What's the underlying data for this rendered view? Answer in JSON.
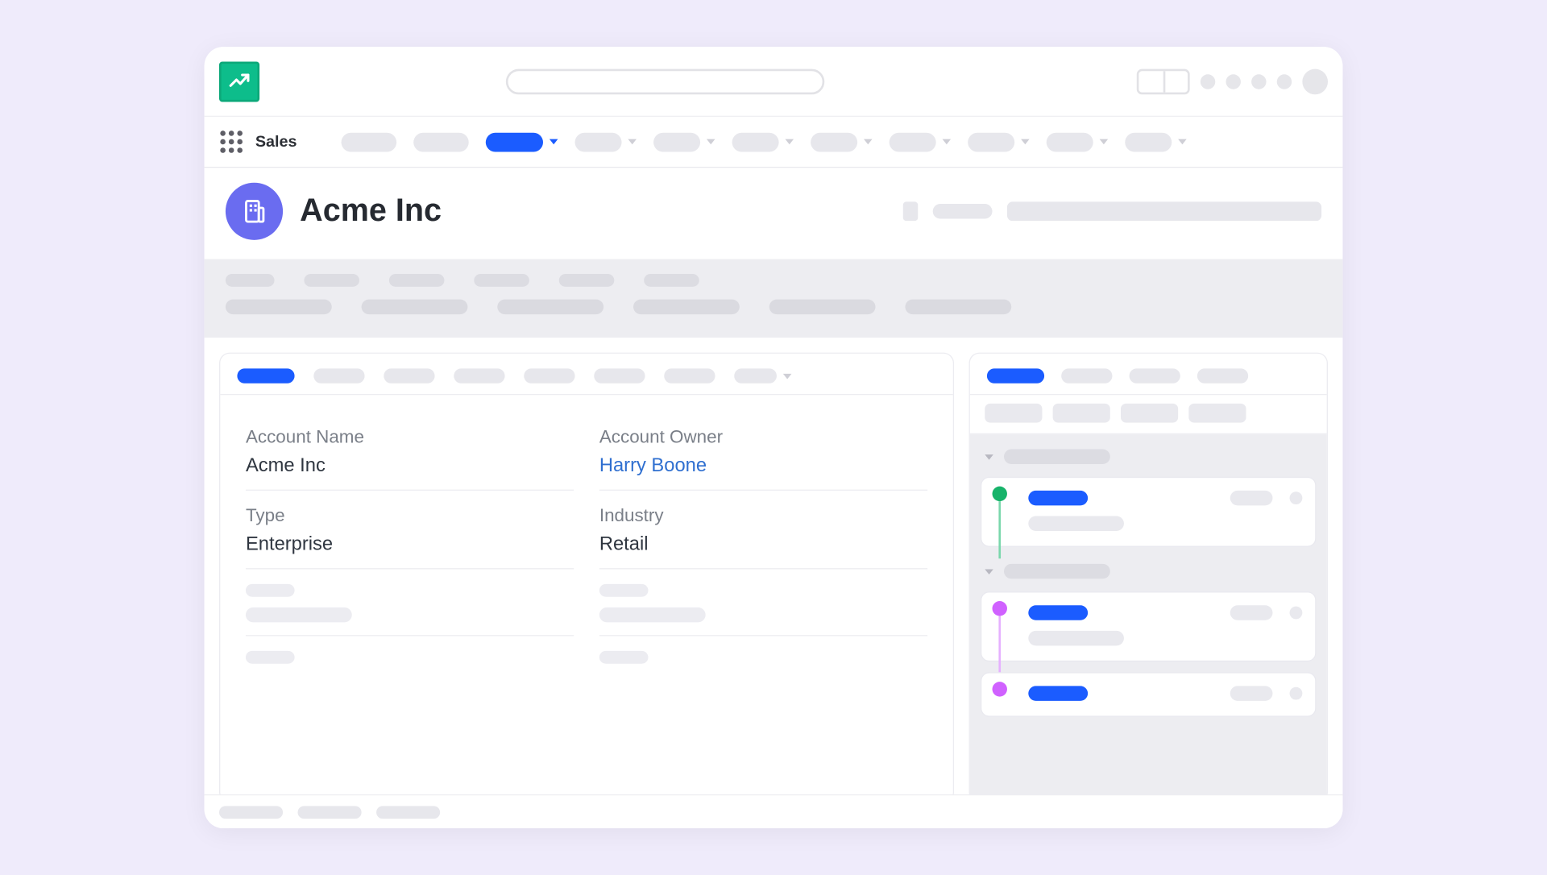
{
  "app": {
    "name": "Sales",
    "logo_icon": "trending-up-icon",
    "record_icon": "building-icon"
  },
  "colors": {
    "accent_blue": "#1b5cff",
    "record_header": "#6a6cf0",
    "timeline_green": "#17b36a",
    "timeline_purple": "#d061ff",
    "logo_bg": "#0dbd8b"
  },
  "record": {
    "title": "Acme Inc"
  },
  "details": {
    "fields": [
      {
        "label": "Account Name",
        "value": "Acme Inc",
        "is_link": false
      },
      {
        "label": "Account Owner",
        "value": "Harry Boone",
        "is_link": true
      },
      {
        "label": "Type",
        "value": "Enterprise",
        "is_link": false
      },
      {
        "label": "Industry",
        "value": "Retail",
        "is_link": false
      }
    ]
  }
}
